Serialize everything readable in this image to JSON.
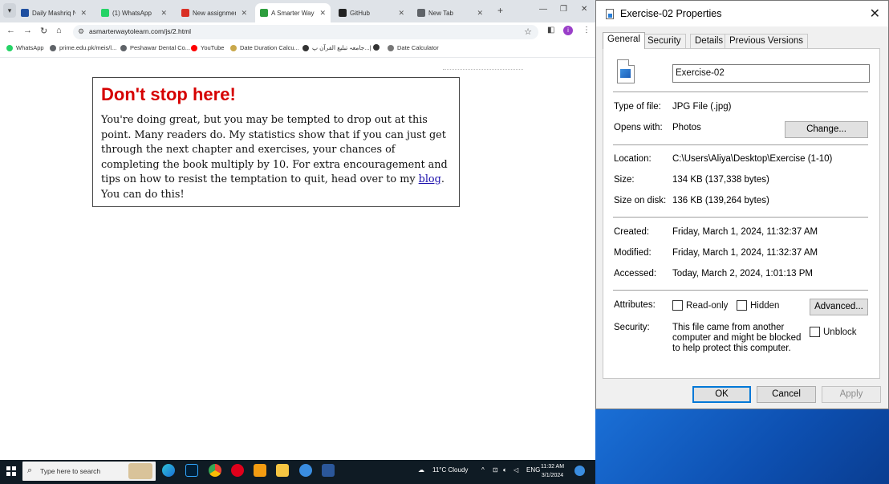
{
  "browser": {
    "tabs": [
      {
        "label": "Daily Mashriq New",
        "color": "#1f4fa0"
      },
      {
        "label": "(1) WhatsApp",
        "color": "#25d366"
      },
      {
        "label": "New assignment",
        "color": "#d93025"
      },
      {
        "label": "A Smarter Way to",
        "color": "#2e9e3e",
        "active": true
      },
      {
        "label": "GitHub",
        "color": "#222222"
      },
      {
        "label": "New Tab",
        "color": "#5f6368"
      }
    ],
    "new_tab": "+",
    "url": "asmarterwaytolearn.com/js/2.html",
    "profile_initial": "i",
    "bookmarks": [
      {
        "label": "WhatsApp",
        "color": "#25d366"
      },
      {
        "label": "prime.edu.pk/meis/l...",
        "color": "#5f6368"
      },
      {
        "label": "Peshawar Dental Co...",
        "color": "#5f6368"
      },
      {
        "label": "YouTube",
        "color": "#ff0000"
      },
      {
        "label": "Date Duration Calcu...",
        "color": "#c9a84b"
      },
      {
        "label": "جامعہ تبلیغ القرآن پ...|",
        "color": "#333333"
      },
      {
        "label": "",
        "color": "#333333"
      },
      {
        "label": "Date Calculator",
        "color": "#777777"
      }
    ]
  },
  "page": {
    "heading": "Don't stop here!",
    "paragraph_before_link": "You're doing great, but you may be tempted to drop out at this point. Many readers do. My statistics show that if you can just get through the next chapter and exercises, your chances of completing the book multiply by 10. For extra encouragement and tips on how to resist the temptation to quit, head over to my ",
    "link_text": "blog",
    "paragraph_after_link": ". You can do this!"
  },
  "taskbar": {
    "search_placeholder": "Type here to search",
    "weather": "11°C  Cloudy",
    "language": "ENG",
    "time": "11:32 AM",
    "date": "3/1/2024"
  },
  "dialog": {
    "title": "Exercise-02 Properties",
    "tabs": [
      "General",
      "Security",
      "Details",
      "Previous Versions"
    ],
    "active_tab": "General",
    "file_name": "Exercise-02",
    "type_label": "Type of file:",
    "type_value": "JPG File (.jpg)",
    "opens_label": "Opens with:",
    "opens_value": "Photos",
    "change_button": "Change...",
    "location_label": "Location:",
    "location_value": "C:\\Users\\Aliya\\Desktop\\Exercise (1-10)",
    "size_label": "Size:",
    "size_value": "134 KB (137,338 bytes)",
    "size_disk_label": "Size on disk:",
    "size_disk_value": "136 KB (139,264 bytes)",
    "created_label": "Created:",
    "created_value": "Friday, March 1, 2024, 11:32:37 AM",
    "modified_label": "Modified:",
    "modified_value": "Friday, March 1, 2024, 11:32:37 AM",
    "accessed_label": "Accessed:",
    "accessed_value": "Today, March 2, 2024, 1:01:13 PM",
    "attributes_label": "Attributes:",
    "readonly_label": "Read-only",
    "hidden_label": "Hidden",
    "advanced_button": "Advanced...",
    "security_label": "Security:",
    "security_text": "This file came from another computer and might be blocked to help protect this computer.",
    "unblock_label": "Unblock",
    "ok_button": "OK",
    "cancel_button": "Cancel",
    "apply_button": "Apply"
  }
}
